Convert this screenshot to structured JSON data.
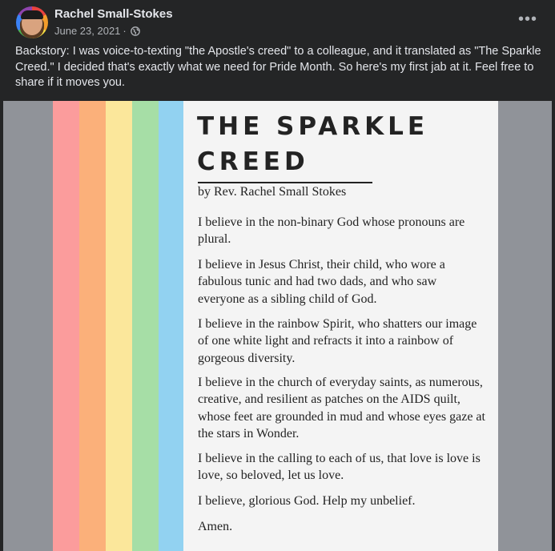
{
  "post": {
    "author": "Rachel Small-Stokes",
    "date": "June 23, 2021",
    "separator": "·",
    "privacy_icon": "globe-icon",
    "more_icon": "more-options-icon",
    "more_label": "•••",
    "body": "Backstory: I was voice-to-texting \"the Apostle's creed\" to a colleague, and it translated as \"The Sparkle Creed.\" I decided that's exactly what we need for Pride Month. So here's my first jab at it. Feel free to share if it moves you."
  },
  "image": {
    "title_line1": "THE SPARKLE",
    "title_line2": "CREED",
    "byline": "by Rev. Rachel Small Stokes",
    "paragraphs": [
      "I believe in the non-binary God whose pronouns are plural.",
      "I believe in Jesus Christ, their child, who wore a fabulous tunic and had two dads, and who saw everyone as a sibling child of God.",
      "I believe in the rainbow Spirit, who shatters our image of one white light and refracts it into a rainbow of gorgeous diversity.",
      "I believe in the church of everyday saints, as numerous, creative, and resilient as patches on the AIDS quilt, whose feet are grounded in mud and whose eyes gaze at the stars in Wonder.",
      "I believe in the calling to each of us, that love is love is love, so beloved, let us love.",
      "I believe, glorious God. Help my unbelief.",
      "Amen."
    ],
    "stripe_colors": [
      "#fb9c9c",
      "#fbb07a",
      "#fbe79b",
      "#a6dea6",
      "#92d2f1"
    ]
  }
}
